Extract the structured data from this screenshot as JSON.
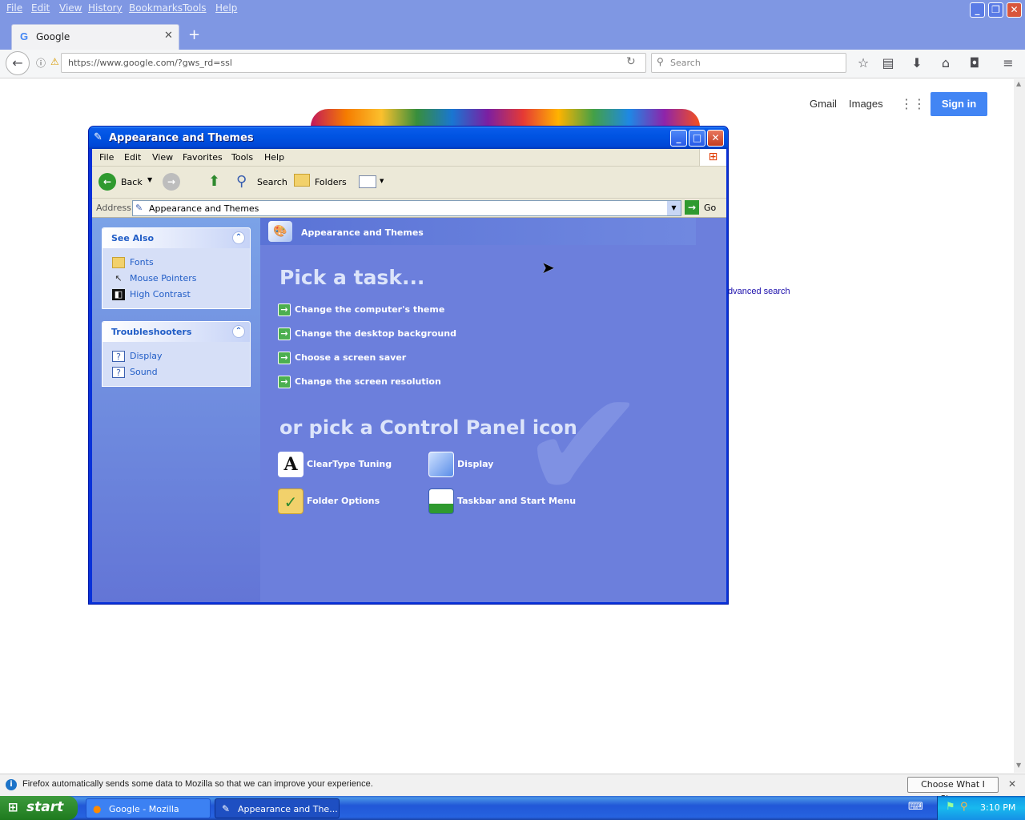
{
  "firefox": {
    "menu": [
      "File",
      "Edit",
      "View",
      "History",
      "Bookmarks",
      "Tools",
      "Help"
    ],
    "tab_title": "Google",
    "url": "https://www.google.com/?gws_rd=ssl",
    "search_placeholder": "Search",
    "notification": "Firefox automatically sends some data to Mozilla so that we can improve your experience.",
    "notification_button": "Choose What I Share"
  },
  "google": {
    "gmail": "Gmail",
    "images": "Images",
    "sign_in": "Sign in",
    "adv_search_fragment": "dvanced search"
  },
  "xp_window": {
    "title": "Appearance and Themes",
    "menu": [
      "File",
      "Edit",
      "View",
      "Favorites",
      "Tools",
      "Help"
    ],
    "toolbar": {
      "back": "Back",
      "search": "Search",
      "folders": "Folders"
    },
    "address_label": "Address",
    "address_value": "Appearance and Themes",
    "go": "Go",
    "see_also": {
      "title": "See Also",
      "items": [
        "Fonts",
        "Mouse Pointers",
        "High Contrast"
      ]
    },
    "troubleshooters": {
      "title": "Troubleshooters",
      "items": [
        "Display",
        "Sound"
      ]
    },
    "category_header": "Appearance and Themes",
    "pick_task": "Pick a task...",
    "tasks": [
      "Change the computer's theme",
      "Change the desktop background",
      "Choose a screen saver",
      "Change the screen resolution"
    ],
    "pick_icon": "or pick a Control Panel icon",
    "icons": [
      "ClearType Tuning",
      "Display",
      "Folder Options",
      "Taskbar and Start Menu"
    ]
  },
  "taskbar": {
    "start": "start",
    "items": [
      "Google - Mozilla Firefox",
      "Appearance and The..."
    ],
    "clock": "3:10 PM"
  }
}
